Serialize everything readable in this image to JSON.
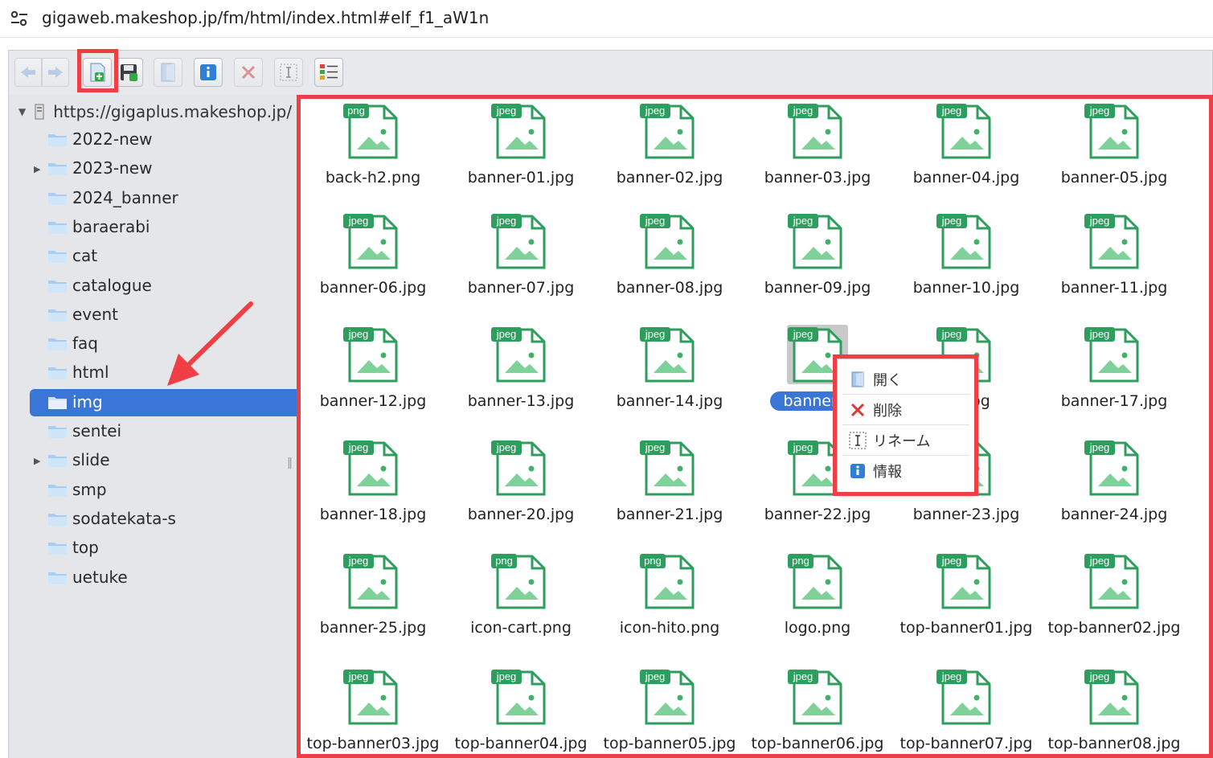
{
  "browser": {
    "url": "gigaweb.makeshop.jp/fm/html/index.html#elf_f1_aW1n"
  },
  "toolbar": {
    "buttons": [
      {
        "name": "back-button",
        "icon": "arrow-left-icon",
        "enabled": false
      },
      {
        "name": "forward-button",
        "icon": "arrow-right-icon",
        "enabled": false
      },
      {
        "name": "upload-button",
        "icon": "upload-icon",
        "enabled": true
      },
      {
        "name": "download-button",
        "icon": "save-icon",
        "enabled": true
      },
      {
        "name": "open-button",
        "icon": "open-icon",
        "enabled": false
      },
      {
        "name": "info-button",
        "icon": "info-icon",
        "enabled": true
      },
      {
        "name": "delete-button",
        "icon": "delete-icon",
        "enabled": false
      },
      {
        "name": "rename-button",
        "icon": "rename-icon",
        "enabled": false
      },
      {
        "name": "view-list-button",
        "icon": "list-view-icon",
        "enabled": true
      }
    ]
  },
  "tree": {
    "root_label": "https://gigaplus.makeshop.jp/",
    "items": [
      {
        "label": "2022-new",
        "expandable": false
      },
      {
        "label": "2023-new",
        "expandable": true
      },
      {
        "label": "2024_banner",
        "expandable": false
      },
      {
        "label": "baraerabi",
        "expandable": false
      },
      {
        "label": "cat",
        "expandable": false
      },
      {
        "label": "catalogue",
        "expandable": false
      },
      {
        "label": "event",
        "expandable": false
      },
      {
        "label": "faq",
        "expandable": false
      },
      {
        "label": "html",
        "expandable": false
      },
      {
        "label": "img",
        "expandable": false,
        "selected": true
      },
      {
        "label": "sentei",
        "expandable": false
      },
      {
        "label": "slide",
        "expandable": true
      },
      {
        "label": "smp",
        "expandable": false
      },
      {
        "label": "sodatekata-s",
        "expandable": false
      },
      {
        "label": "top",
        "expandable": false
      },
      {
        "label": "uetuke",
        "expandable": false
      }
    ]
  },
  "files": [
    {
      "name": "back-h2.png",
      "type": "png"
    },
    {
      "name": "banner-01.jpg",
      "type": "jpeg"
    },
    {
      "name": "banner-02.jpg",
      "type": "jpeg"
    },
    {
      "name": "banner-03.jpg",
      "type": "jpeg"
    },
    {
      "name": "banner-04.jpg",
      "type": "jpeg"
    },
    {
      "name": "banner-05.jpg",
      "type": "jpeg"
    },
    {
      "name": "banner-06.jpg",
      "type": "jpeg"
    },
    {
      "name": "banner-07.jpg",
      "type": "jpeg"
    },
    {
      "name": "banner-08.jpg",
      "type": "jpeg"
    },
    {
      "name": "banner-09.jpg",
      "type": "jpeg"
    },
    {
      "name": "banner-10.jpg",
      "type": "jpeg"
    },
    {
      "name": "banner-11.jpg",
      "type": "jpeg"
    },
    {
      "name": "banner-12.jpg",
      "type": "jpeg"
    },
    {
      "name": "banner-13.jpg",
      "type": "jpeg"
    },
    {
      "name": "banner-14.jpg",
      "type": "jpeg"
    },
    {
      "name": "banner-1",
      "type": "jpeg",
      "selected": true
    },
    {
      "name": "16.jpg",
      "type": "jpeg"
    },
    {
      "name": "banner-17.jpg",
      "type": "jpeg"
    },
    {
      "name": "banner-18.jpg",
      "type": "jpeg"
    },
    {
      "name": "banner-20.jpg",
      "type": "jpeg"
    },
    {
      "name": "banner-21.jpg",
      "type": "jpeg"
    },
    {
      "name": "banner-22.jpg",
      "type": "jpeg"
    },
    {
      "name": "banner-23.jpg",
      "type": "jpeg"
    },
    {
      "name": "banner-24.jpg",
      "type": "jpeg"
    },
    {
      "name": "banner-25.jpg",
      "type": "jpeg"
    },
    {
      "name": "icon-cart.png",
      "type": "png"
    },
    {
      "name": "icon-hito.png",
      "type": "png"
    },
    {
      "name": "logo.png",
      "type": "png"
    },
    {
      "name": "top-banner01.jpg",
      "type": "jpeg"
    },
    {
      "name": "top-banner02.jpg",
      "type": "jpeg"
    },
    {
      "name": "top-banner03.jpg",
      "type": "jpeg"
    },
    {
      "name": "top-banner04.jpg",
      "type": "jpeg"
    },
    {
      "name": "top-banner05.jpg",
      "type": "jpeg"
    },
    {
      "name": "top-banner06.jpg",
      "type": "jpeg"
    },
    {
      "name": "top-banner07.jpg",
      "type": "jpeg"
    },
    {
      "name": "top-banner08.jpg",
      "type": "jpeg"
    }
  ],
  "context_menu": {
    "items": [
      {
        "label": "開く",
        "icon": "open-icon"
      },
      {
        "label": "削除",
        "icon": "delete-icon"
      },
      {
        "label": "リネーム",
        "icon": "rename-icon"
      },
      {
        "label": "情報",
        "icon": "info-icon"
      }
    ]
  },
  "colors": {
    "highlight": "#ef3f45",
    "selection": "#3a76d8",
    "file_icon": "#2e9e5e"
  }
}
